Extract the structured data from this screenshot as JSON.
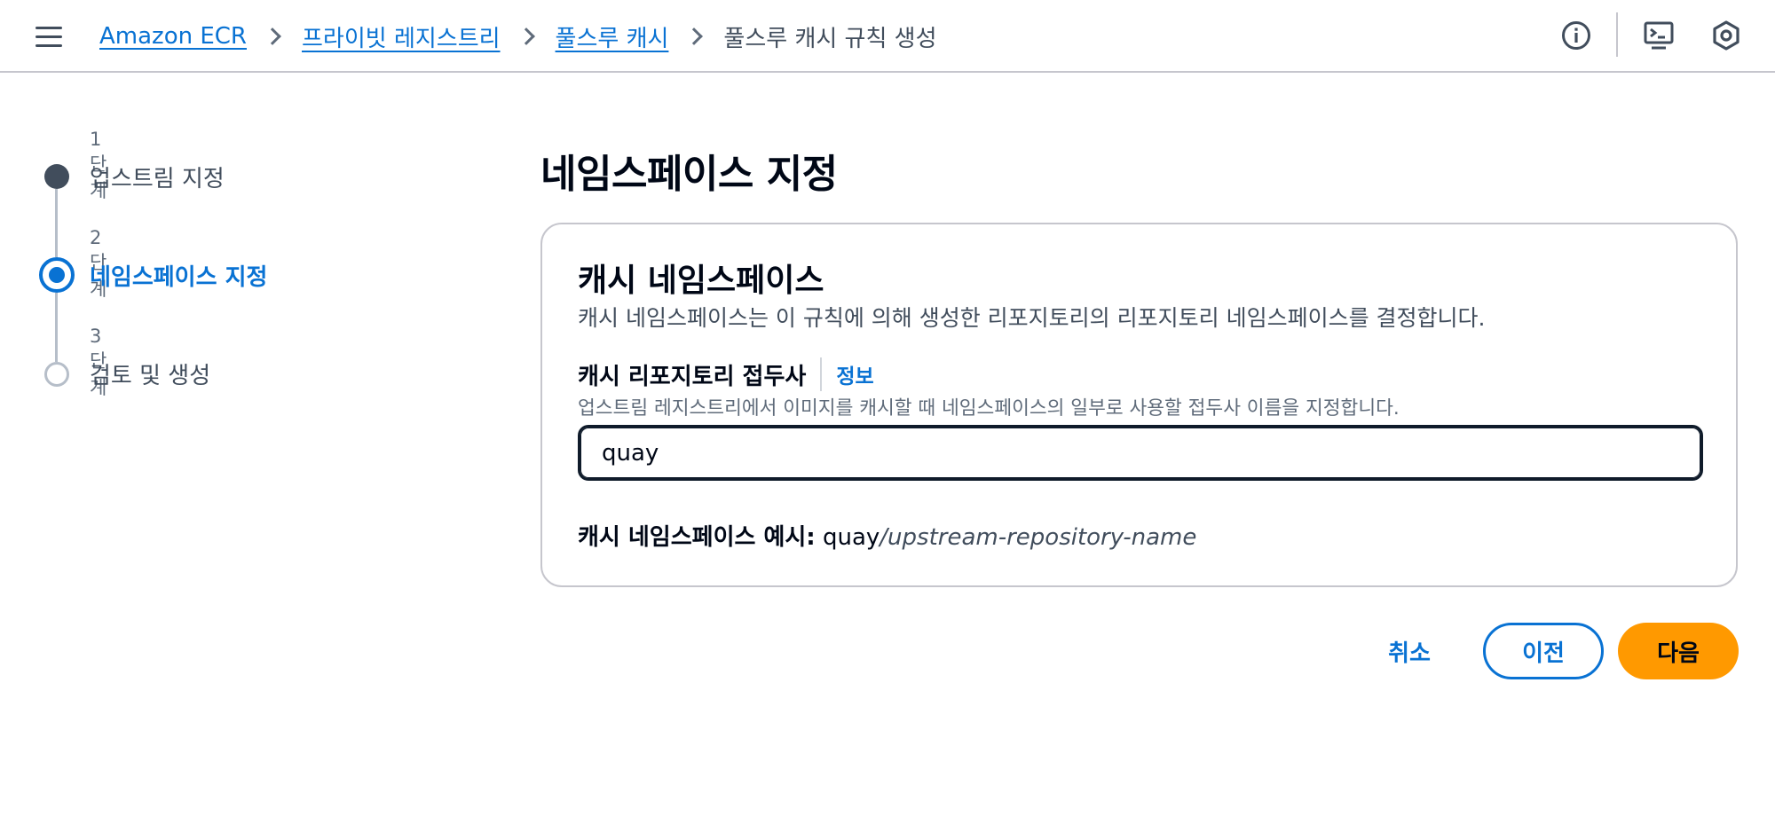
{
  "breadcrumb": {
    "items": [
      "Amazon ECR",
      "프라이빗 레지스트리",
      "풀스루 캐시"
    ],
    "current": "풀스루 캐시 규칙 생성"
  },
  "header_icons": [
    "info-icon",
    "cloudshell-icon",
    "settings-icon"
  ],
  "steps": [
    {
      "number": "1단계",
      "title": "업스트림 지정",
      "state": "completed"
    },
    {
      "number": "2단계",
      "title": "네임스페이스 지정",
      "state": "active"
    },
    {
      "number": "3단계",
      "title": "검토 및 생성",
      "state": "pending"
    }
  ],
  "page_title": "네임스페이스 지정",
  "card": {
    "title": "캐시 네임스페이스",
    "description": "캐시 네임스페이스는 이 규칙에 의해 생성한 리포지토리의 리포지토리 네임스페이스를 결정합니다.",
    "field": {
      "label": "캐시 리포지토리 접두사",
      "info_link": "정보",
      "description": "업스트림 레지스트리에서 이미지를 캐시할 때 네임스페이스의 일부로 사용할 접두사 이름을 지정합니다.",
      "value": "quay"
    },
    "example": {
      "label": "캐시 네임스페이스 예시:",
      "prefix": "quay",
      "suffix": "/upstream-repository-name"
    }
  },
  "buttons": {
    "cancel": "취소",
    "previous": "이전",
    "next": "다음"
  },
  "colors": {
    "link": "#0972d3",
    "primary_button": "#ff9900",
    "text": "#000716"
  }
}
